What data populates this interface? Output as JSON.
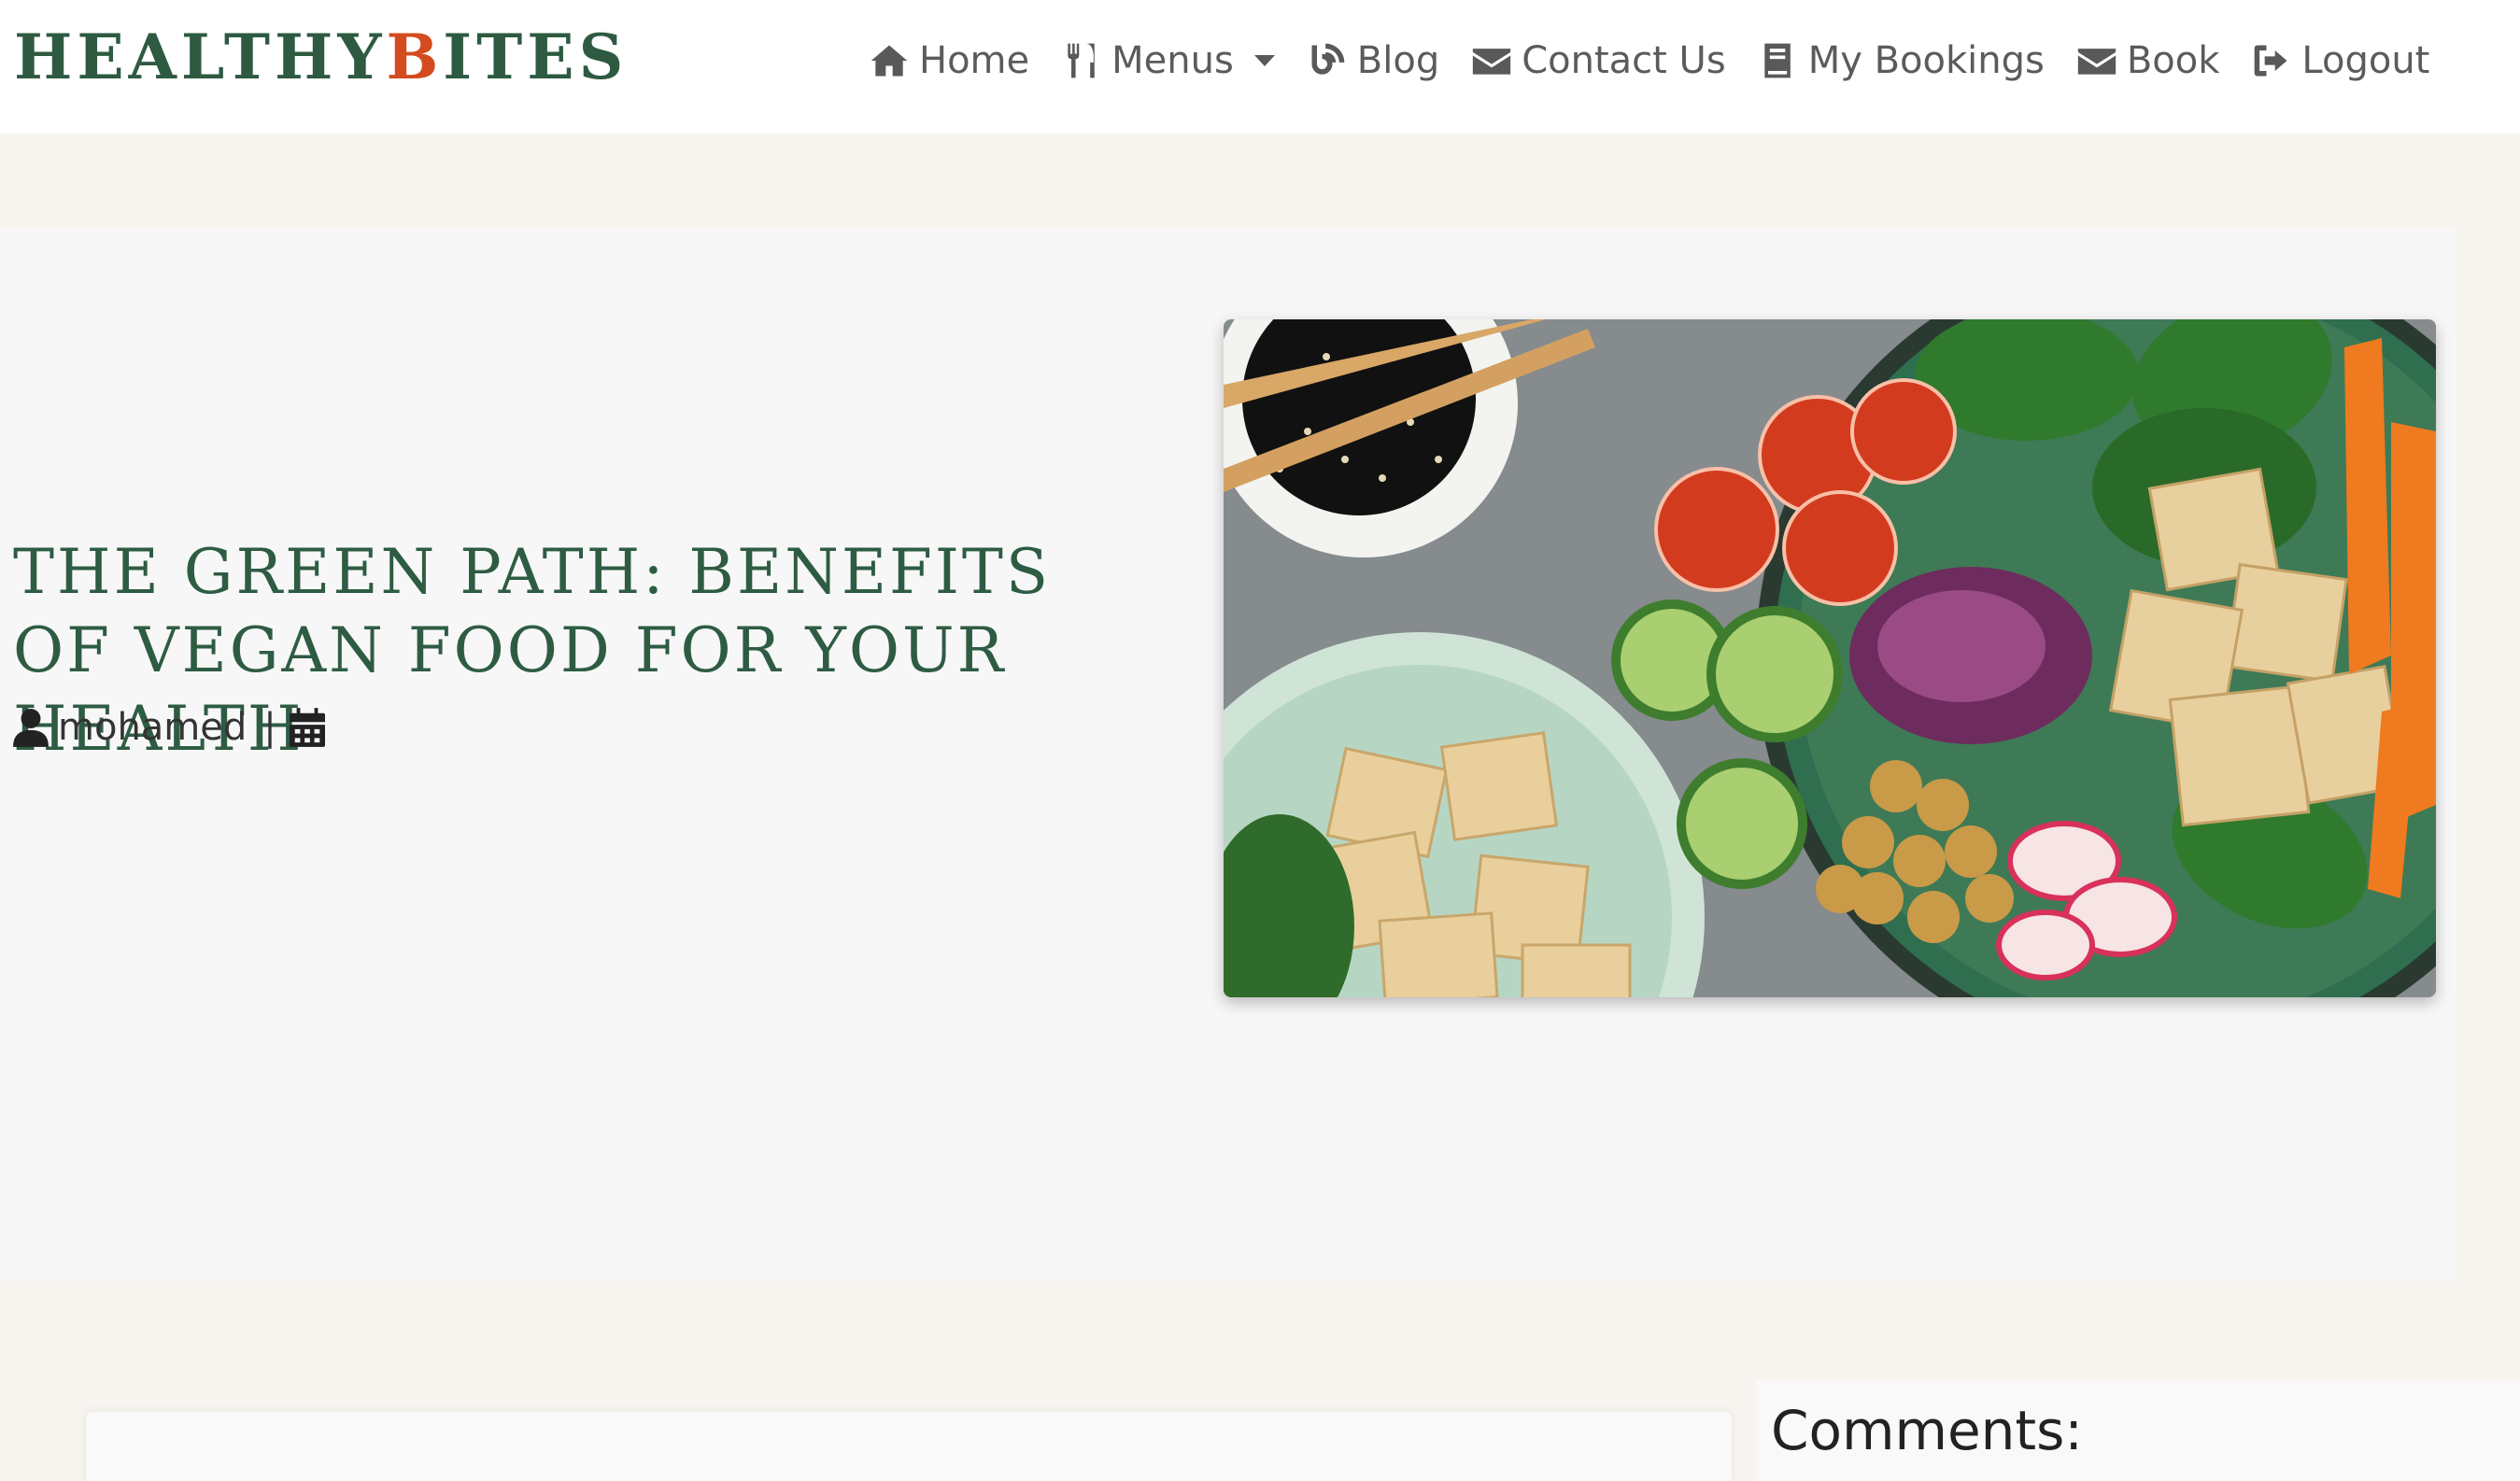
{
  "brand": {
    "part1": "HEALTHY",
    "accent": "B",
    "part2": "ITES",
    "color": "#2d5a41",
    "accent_color": "#d34b1f"
  },
  "nav": {
    "items": [
      {
        "label": "Home",
        "icon": "home-icon"
      },
      {
        "label": "Menus",
        "icon": "utensils-icon",
        "dropdown": true
      },
      {
        "label": "Blog",
        "icon": "blog-icon"
      },
      {
        "label": "Contact Us",
        "icon": "envelope-icon"
      },
      {
        "label": "My Bookings",
        "icon": "book-icon"
      },
      {
        "label": "Book",
        "icon": "envelope-icon"
      },
      {
        "label": "Logout",
        "icon": "logout-icon"
      }
    ]
  },
  "post": {
    "title": "THE GREEN PATH: BENEFITS OF VEGAN FOOD FOR YOUR HEALTH",
    "author": "mohamed",
    "separator": "|",
    "author_icon": "user-icon",
    "date_icon": "calendar-icon",
    "image": "vegan bowl photo"
  },
  "comments": {
    "heading": "Comments:"
  }
}
